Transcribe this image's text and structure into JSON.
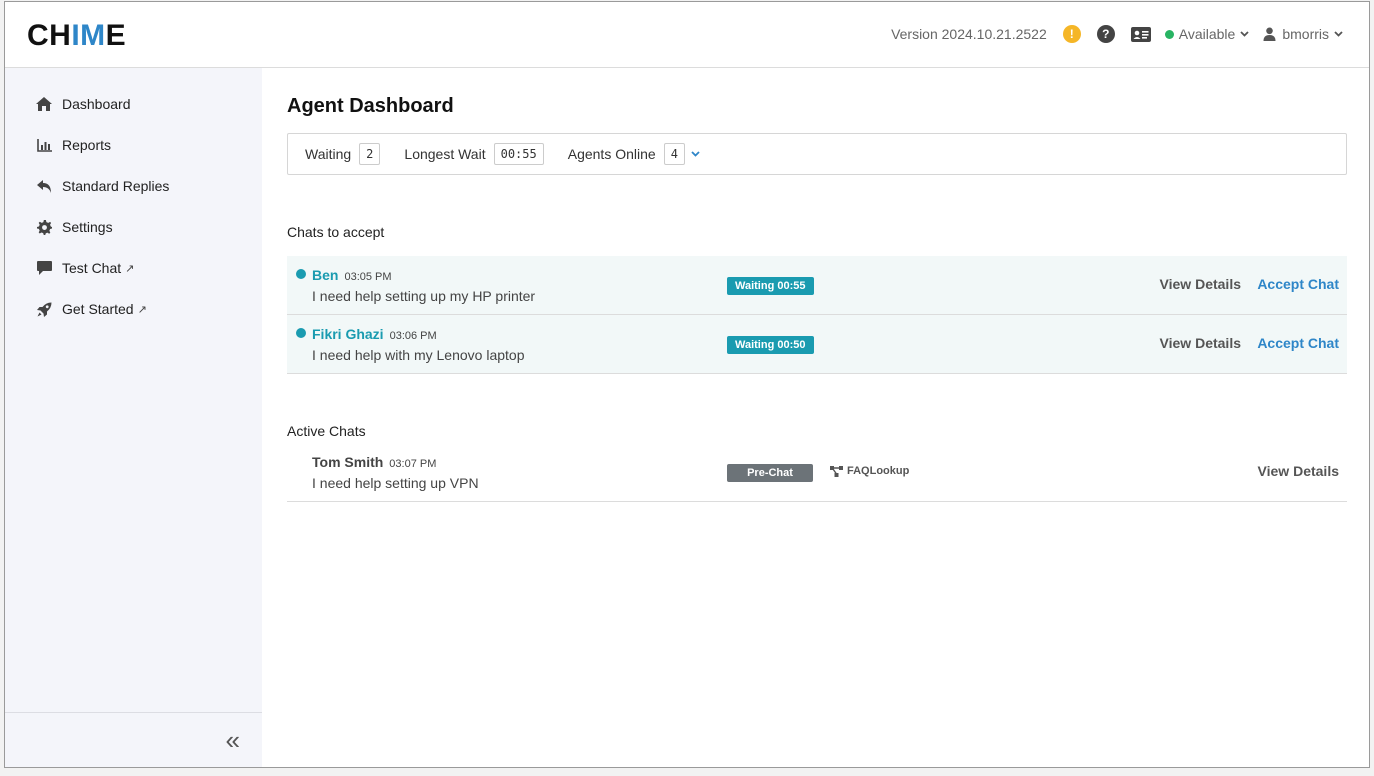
{
  "header": {
    "logo_left": "CH",
    "logo_mid": "IM",
    "logo_right": "E",
    "version": "Version 2024.10.21.2522",
    "warning_glyph": "!",
    "help_glyph": "?",
    "status": "Available",
    "username": "bmorris"
  },
  "sidebar": {
    "items": [
      {
        "label": "Dashboard",
        "icon": "home-icon"
      },
      {
        "label": "Reports",
        "icon": "bar-chart-icon"
      },
      {
        "label": "Standard Replies",
        "icon": "reply-icon"
      },
      {
        "label": "Settings",
        "icon": "gear-icon"
      },
      {
        "label": "Test Chat",
        "icon": "chat-bubble-icon",
        "external": "↗"
      },
      {
        "label": "Get Started",
        "icon": "rocket-icon",
        "external": "↗"
      }
    ],
    "collapse_glyph": "«"
  },
  "main": {
    "title": "Agent Dashboard",
    "stats": {
      "waiting_label": "Waiting",
      "waiting_value": "2",
      "longest_label": "Longest Wait",
      "longest_value": "00:55",
      "agents_label": "Agents Online",
      "agents_value": "4"
    },
    "accept_section_title": "Chats to accept",
    "accept_chats": [
      {
        "name": "Ben",
        "time": "03:05 PM",
        "message": "I need help setting up my HP printer",
        "badge": "Waiting 00:55",
        "view": "View Details",
        "accept": "Accept Chat"
      },
      {
        "name": "Fikri Ghazi",
        "time": "03:06 PM",
        "message": "I need help with my Lenovo laptop",
        "badge": "Waiting 00:50",
        "view": "View Details",
        "accept": "Accept Chat"
      }
    ],
    "active_section_title": "Active Chats",
    "active_chats": [
      {
        "name": "Tom Smith",
        "time": "03:07 PM",
        "message": "I need help setting up VPN",
        "badge": "Pre-Chat",
        "flow": "FAQLookup",
        "view": "View Details"
      }
    ]
  },
  "colors": {
    "accent": "#2e86c8",
    "teal": "#1a9bb0",
    "warning": "#f5b627",
    "online": "#28b463",
    "sidebar_bg": "#f4f5fa"
  }
}
